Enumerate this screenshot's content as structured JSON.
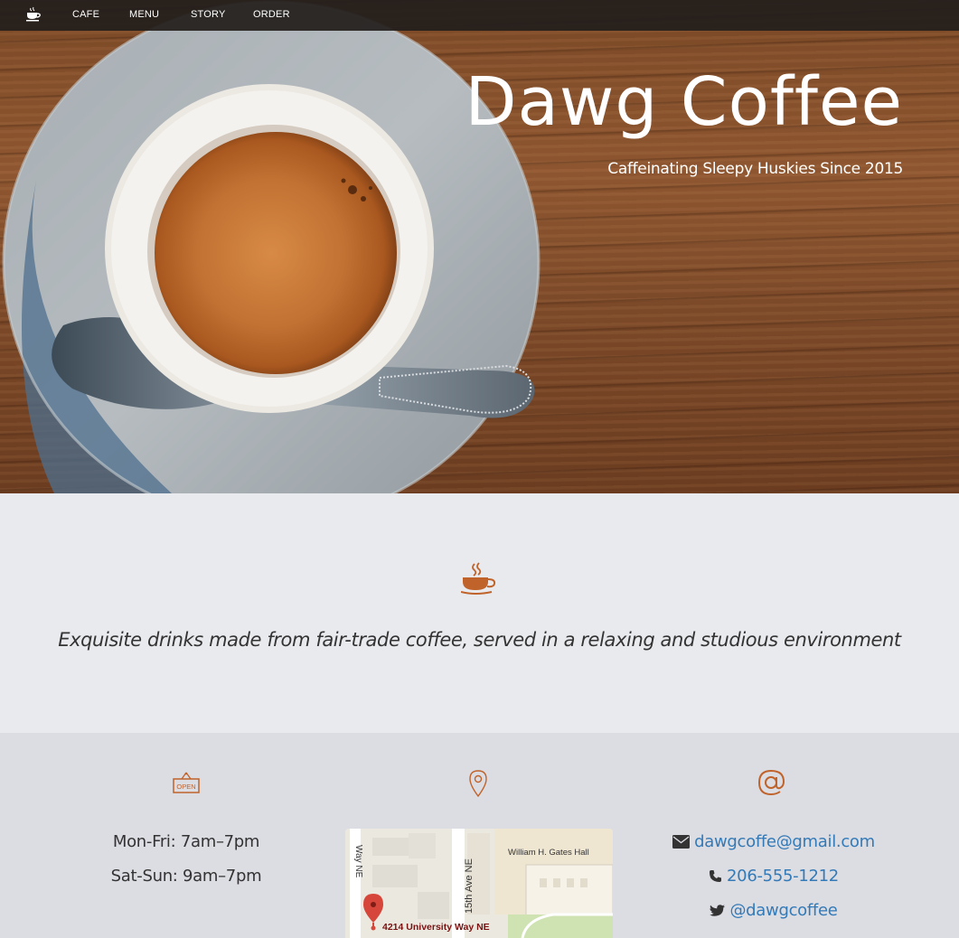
{
  "nav": {
    "brand_icon": "coffee-cup-icon",
    "links": [
      "CAFE",
      "MENU",
      "STORY",
      "ORDER"
    ]
  },
  "hero": {
    "title": "Dawg Coffee",
    "subtitle": "Caffeinating Sleepy Huskies Since 2015"
  },
  "intro": {
    "icon": "steaming-coffee-icon",
    "tagline": "Exquisite drinks made from fair-trade coffee, served in a relaxing and studious environment"
  },
  "hours": {
    "icon": "open-sign-icon",
    "sign_text": "OPEN",
    "lines": [
      "Mon-Fri: 7am–7pm",
      "Sat-Sun: 9am–7pm"
    ]
  },
  "location": {
    "icon": "map-pin-icon",
    "map": {
      "street_left": "Way NE",
      "street_center": "15th Ave NE",
      "building": "William H. Gates Hall",
      "address": "4214 University Way NE"
    }
  },
  "contact": {
    "icon": "at-sign-icon",
    "email": "dawgcoffe@gmail.com",
    "phone": "206-555-1212",
    "twitter": "@dawgcoffee"
  },
  "colors": {
    "accent": "#c0632a",
    "link": "#337ab7",
    "nav_bg": "#221e1c"
  }
}
